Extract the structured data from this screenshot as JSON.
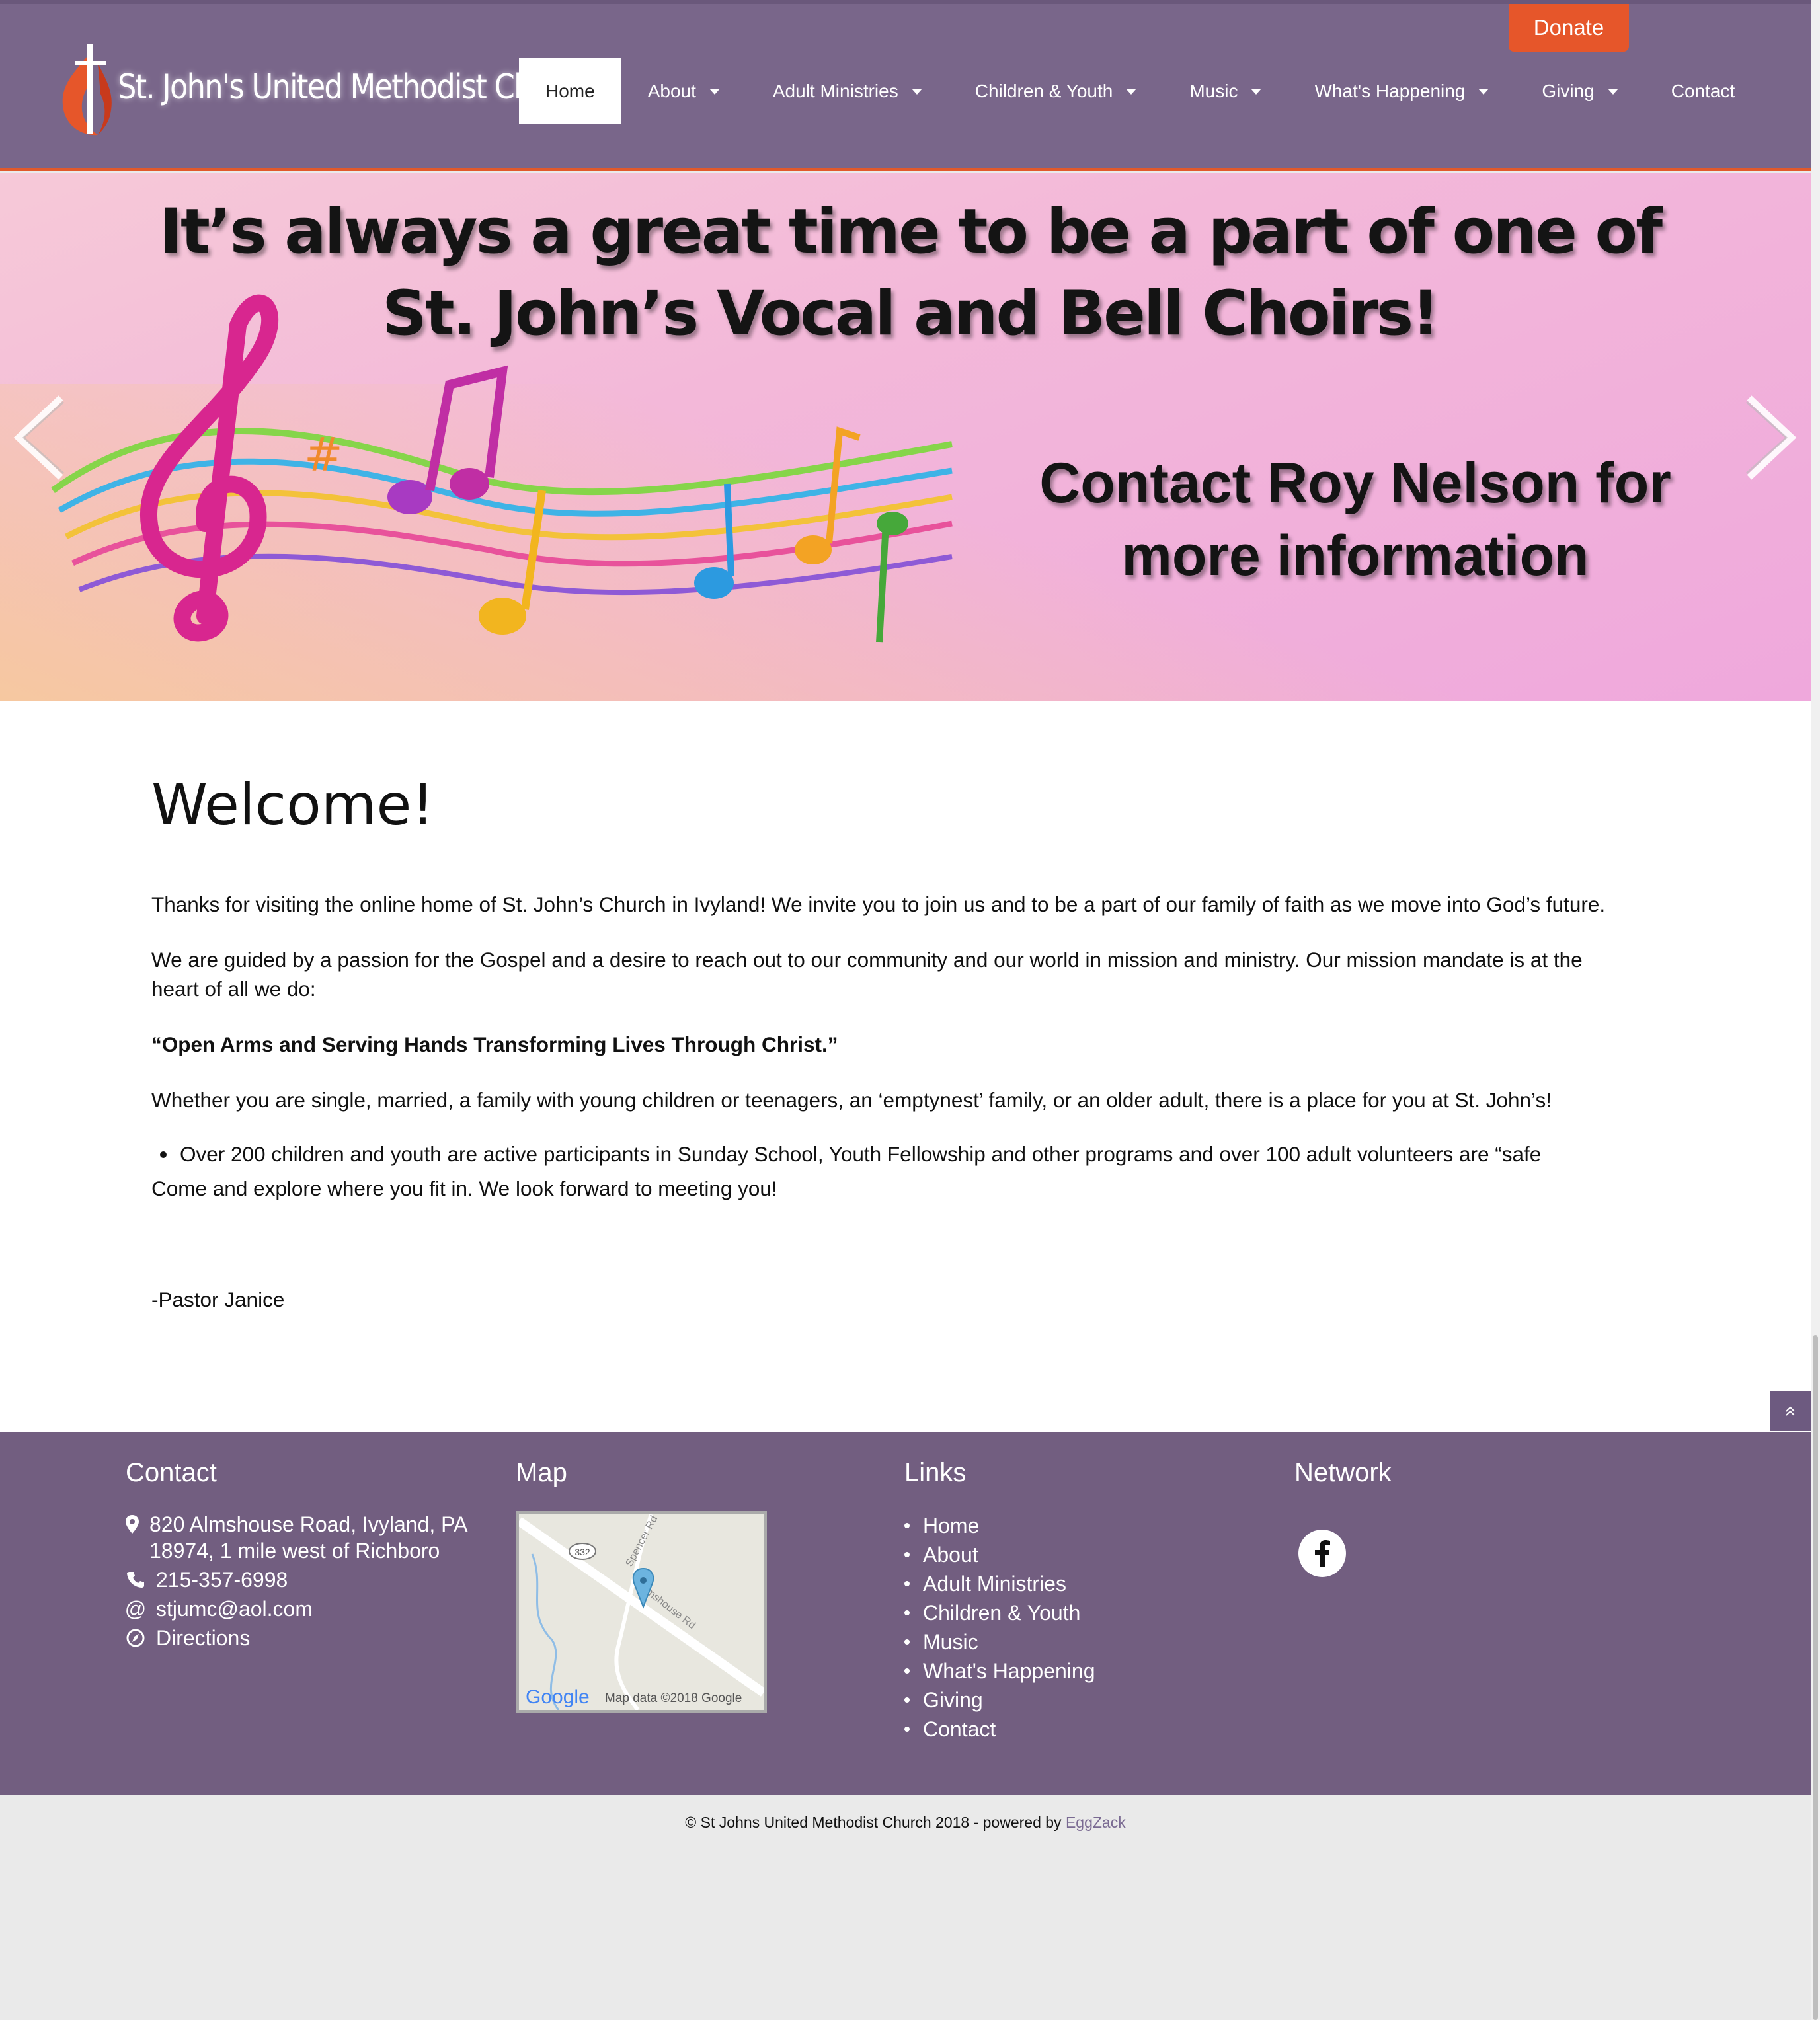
{
  "header": {
    "logo_text": "St. John's United Methodist Church",
    "donate_label": "Donate",
    "nav": [
      {
        "label": "Home",
        "active": true,
        "dropdown": false
      },
      {
        "label": "About",
        "active": false,
        "dropdown": true
      },
      {
        "label": "Adult Ministries",
        "active": false,
        "dropdown": true
      },
      {
        "label": "Children & Youth",
        "active": false,
        "dropdown": true
      },
      {
        "label": "Music",
        "active": false,
        "dropdown": true
      },
      {
        "label": "What's Happening",
        "active": false,
        "dropdown": true
      },
      {
        "label": "Giving",
        "active": false,
        "dropdown": true
      },
      {
        "label": "Contact",
        "active": false,
        "dropdown": false
      }
    ]
  },
  "banner": {
    "line1": "It’s always a great time to be a part of one of",
    "line2": "St. John’s Vocal and Bell Choirs!",
    "contact1": "Contact Roy Nelson for",
    "contact2": "more information"
  },
  "main": {
    "title": "Welcome!",
    "p1": "Thanks for visiting the online home of St. John’s Church in Ivyland! We invite you to join us and to be a part of our family of faith as we move into God’s future.",
    "p2": "We are guided by a passion for the Gospel and a desire to reach out to our community and our world in mission and ministry. Our mission mandate is at the heart of all we do:",
    "mandate": "“Open Arms and Serving Hands Transforming Lives Through Christ.”",
    "p3": "Whether you are single, married, a family with young children or teenagers, an ‘emptynest’ family, or an older adult, there is a place for you at St. John’s!",
    "bullet": "Over 200 children and youth are active participants in Sunday School, Youth Fellowship and other programs and over 100 adult volunteers are “safe",
    "p4": "Come and explore where you fit in. We look forward to meeting you!",
    "signature": "-Pastor Janice"
  },
  "footer": {
    "contact_title": "Contact",
    "address": "820 Almshouse Road, Ivyland, PA 18974, 1 mile west of Richboro",
    "phone": "215-357-6998",
    "email": "stjumc@aol.com",
    "directions": "Directions",
    "map_title": "Map",
    "map": {
      "route": "332",
      "road1": "Spencer Rd",
      "road2": "Almshouse Rd",
      "google": "Google",
      "credit": "Map data ©2018 Google"
    },
    "links_title": "Links",
    "links": [
      "Home",
      "About",
      "Adult Ministries",
      "Children & Youth",
      "Music",
      "What's Happening",
      "Giving",
      "Contact"
    ],
    "network_title": "Network",
    "copyright": "© St Johns United Methodist Church 2018 - powered by",
    "powered_link": "EggZack"
  },
  "colors": {
    "header_bg": "#79668a",
    "accent_orange": "#e6562a",
    "footer_bg": "#725e80",
    "page_bg": "#eaeaea"
  },
  "icons": [
    "map-pin-icon",
    "phone-icon",
    "at-icon",
    "directions-icon",
    "facebook-icon",
    "chevron-left-icon",
    "chevron-right-icon",
    "scroll-up-icon",
    "caret-down-icon"
  ]
}
